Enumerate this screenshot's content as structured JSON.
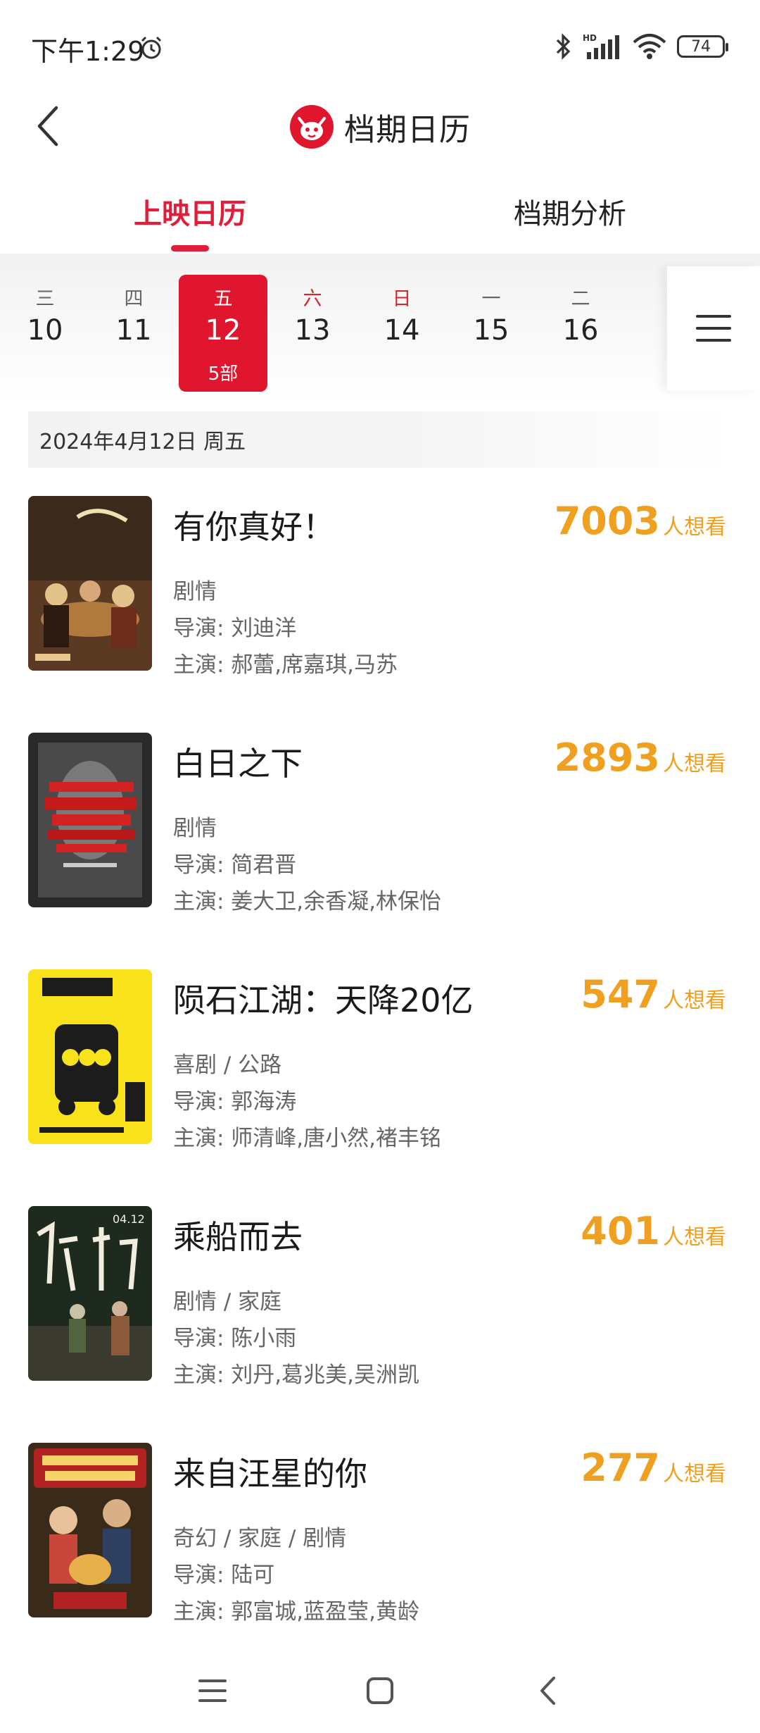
{
  "status": {
    "time": "下午1:29",
    "battery": "74",
    "network": "HD"
  },
  "header": {
    "title": "档期日历"
  },
  "tabs": [
    {
      "label": "上映日历",
      "active": true
    },
    {
      "label": "档期分析",
      "active": false
    }
  ],
  "days": [
    {
      "week": "三",
      "date": "10",
      "count": "",
      "weekend": false,
      "selected": false
    },
    {
      "week": "四",
      "date": "11",
      "count": "",
      "weekend": false,
      "selected": false
    },
    {
      "week": "五",
      "date": "12",
      "count": "5部",
      "weekend": false,
      "selected": true
    },
    {
      "week": "六",
      "date": "13",
      "count": "",
      "weekend": true,
      "selected": false
    },
    {
      "week": "日",
      "date": "14",
      "count": "",
      "weekend": true,
      "selected": false
    },
    {
      "week": "一",
      "date": "15",
      "count": "",
      "weekend": false,
      "selected": false
    },
    {
      "week": "二",
      "date": "16",
      "count": "",
      "weekend": false,
      "selected": false
    }
  ],
  "date_banner": "2024年4月12日  周五",
  "want_label": "人想看",
  "movies": [
    {
      "title": "有你真好！",
      "want": "7003",
      "genre": "剧情",
      "director": "导演: 刘迪洋",
      "cast": "主演: 郝蕾,席嘉琪,马苏",
      "poster_colors": [
        "#3b2a1c",
        "#b07a3e",
        "#e4c28c"
      ]
    },
    {
      "title": "白日之下",
      "want": "2893",
      "genre": "剧情",
      "director": "导演: 简君晋",
      "cast": "主演: 姜大卫,余香凝,林保怡",
      "poster_colors": [
        "#2a2a2a",
        "#d32222",
        "#6b6b6b"
      ]
    },
    {
      "title": "陨石江湖：天降20亿",
      "want": "547",
      "genre": "喜剧 / 公路",
      "director": "导演: 郭海涛",
      "cast": "主演: 师清峰,唐小然,褚丰铭",
      "poster_colors": [
        "#f7e21c",
        "#1c1c1c",
        "#f1d300"
      ]
    },
    {
      "title": "乘船而去",
      "want": "401",
      "genre": "剧情 / 家庭",
      "director": "导演: 陈小雨",
      "cast": "主演: 刘丹,葛兆美,吴洲凯",
      "poster_colors": [
        "#1f2a1f",
        "#52643f",
        "#c9c2a6"
      ]
    },
    {
      "title": "来自汪星的你",
      "want": "277",
      "genre": "奇幻 / 家庭 / 剧情",
      "director": "导演: 陆可",
      "cast": "主演: 郭富城,蓝盈莹,黄龄",
      "poster_colors": [
        "#b22222",
        "#e8b04a",
        "#3a2a1a"
      ]
    }
  ],
  "colors": {
    "accent": "#e01e3c",
    "want": "#f0a020"
  }
}
